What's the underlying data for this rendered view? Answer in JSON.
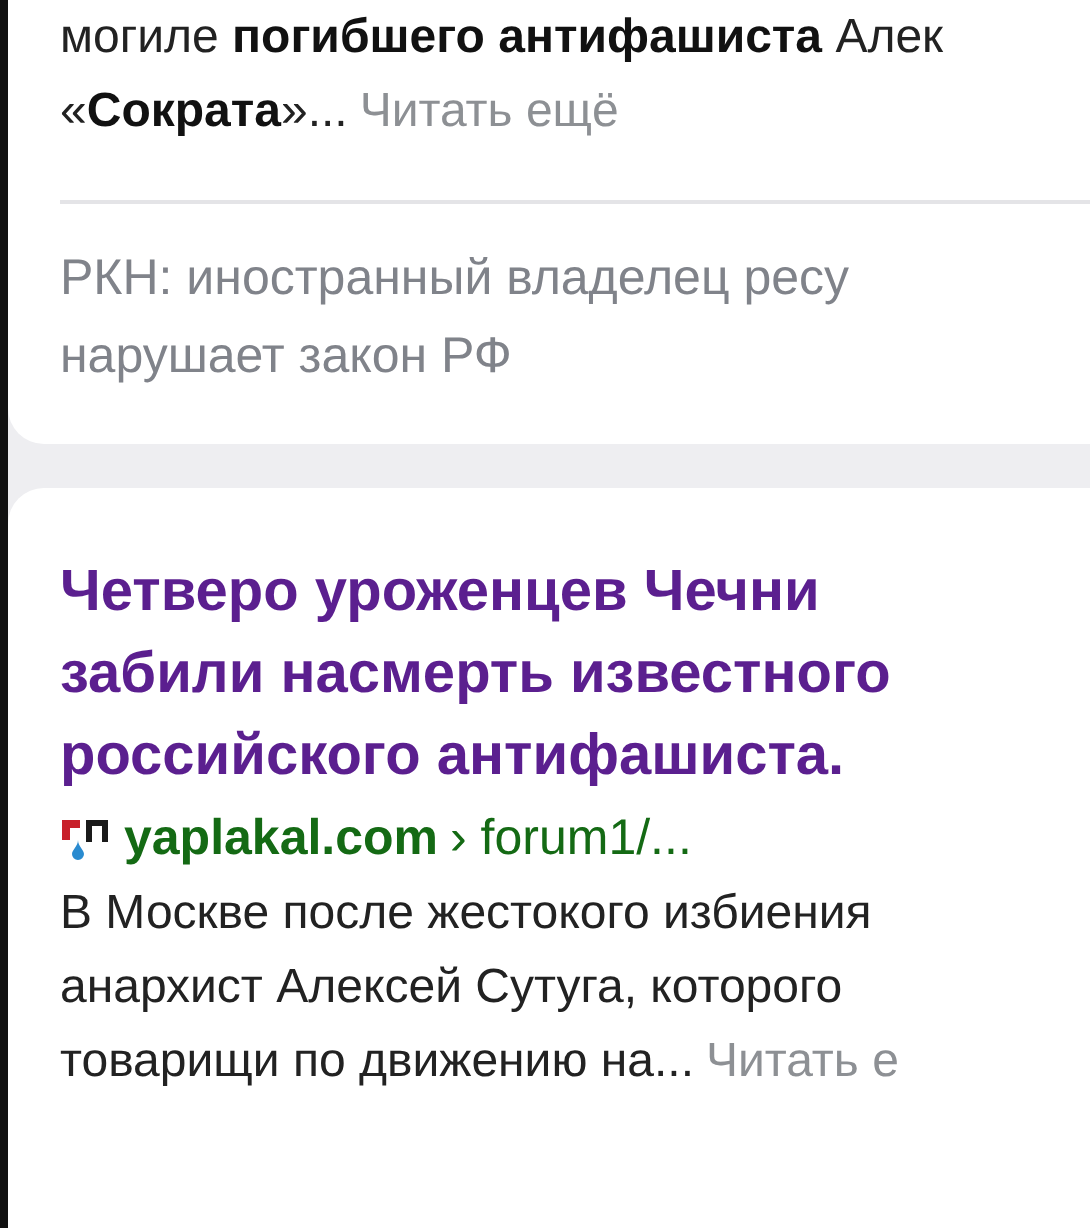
{
  "results": [
    {
      "kind": "snippet_tail",
      "snippet_lines": [
        "могиле **погибшего антифашиста** Алек",
        "«**Сократа**»..."
      ],
      "read_more": "Читать ещё",
      "notice_lines": [
        "РКН: иностранный владелец ресу",
        "нарушает закон РФ"
      ]
    },
    {
      "kind": "result",
      "title_lines": [
        "Четверо уроженцев Чечни",
        "забили насмерть известного",
        "российского антифашиста."
      ],
      "site": "yaplakal.com",
      "path": "› forum1/...",
      "snippet_lines": [
        "В Москве после жестокого избиения",
        "анархист Алексей Сутуга, которого",
        "товарищи по движению на..."
      ],
      "read_more": "Читать е"
    }
  ]
}
